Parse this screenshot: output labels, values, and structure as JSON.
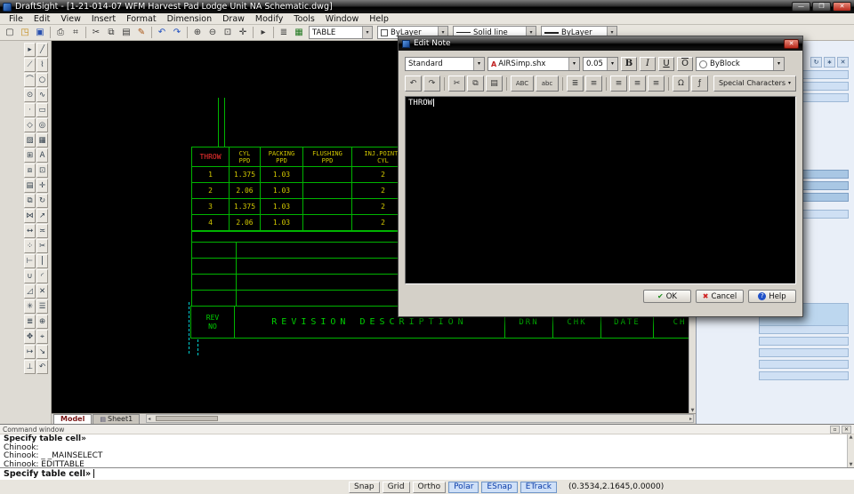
{
  "titlebar": {
    "title": "DraftSight - [1-21-014-07 WFM Harvest Pad Lodge Unit NA Schematic.dwg]"
  },
  "menu": {
    "items": [
      "File",
      "Edit",
      "View",
      "Insert",
      "Format",
      "Dimension",
      "Draw",
      "Modify",
      "Tools",
      "Window",
      "Help"
    ]
  },
  "toolbar": {
    "icons": [
      {
        "name": "new",
        "glyph": "▢"
      },
      {
        "name": "open",
        "glyph": "◳",
        "color": "#c28a18"
      },
      {
        "name": "save",
        "glyph": "▣",
        "color": "#2850b0"
      },
      {
        "sep": true
      },
      {
        "name": "print",
        "glyph": "⎙"
      },
      {
        "name": "print-preview",
        "glyph": "⌗"
      },
      {
        "sep": true
      },
      {
        "name": "cut",
        "glyph": "✂"
      },
      {
        "name": "copy",
        "glyph": "⧉"
      },
      {
        "name": "paste",
        "glyph": "▤"
      },
      {
        "name": "format-painter",
        "glyph": "✎",
        "color": "#a85414"
      },
      {
        "sep": true
      },
      {
        "name": "undo",
        "glyph": "↶",
        "color": "#2050c0"
      },
      {
        "name": "redo",
        "glyph": "↷",
        "color": "#2050c0"
      },
      {
        "sep": true
      },
      {
        "name": "zoom-in",
        "glyph": "⊕"
      },
      {
        "name": "zoom-out",
        "glyph": "⊖"
      },
      {
        "name": "zoom-window",
        "glyph": "⊡"
      },
      {
        "name": "pan",
        "glyph": "✛"
      },
      {
        "sep": true
      },
      {
        "name": "select",
        "glyph": "▸"
      },
      {
        "sep": true
      },
      {
        "name": "layers-manager",
        "glyph": "≣"
      },
      {
        "name": "layer-color",
        "glyph": "▦",
        "color": "#207820"
      }
    ],
    "layer_combo": "TABLE",
    "color_combo": "ByLayer",
    "linestyle_combo": "Solid line",
    "lineweight_combo": "ByLayer"
  },
  "tool_palette": {
    "tools": [
      {
        "name": "select",
        "glyph": "▸"
      },
      {
        "name": "line",
        "glyph": "╱"
      },
      {
        "name": "infinite-line",
        "glyph": "⟋"
      },
      {
        "name": "polyline",
        "glyph": "⌇"
      },
      {
        "name": "arc",
        "glyph": "⌒"
      },
      {
        "name": "circle",
        "glyph": "○"
      },
      {
        "name": "ellipse",
        "glyph": "⊙"
      },
      {
        "name": "spline",
        "glyph": "∿"
      },
      {
        "name": "point",
        "glyph": "·"
      },
      {
        "name": "rectangle",
        "glyph": "▭"
      },
      {
        "name": "polygon",
        "glyph": "◇"
      },
      {
        "name": "ring",
        "glyph": "◎"
      },
      {
        "name": "hatch",
        "glyph": "▨"
      },
      {
        "name": "area",
        "glyph": "▦"
      },
      {
        "name": "table",
        "glyph": "⊞"
      },
      {
        "name": "note",
        "glyph": "A"
      },
      {
        "name": "make-block",
        "glyph": "⧈"
      },
      {
        "name": "insert-block",
        "glyph": "⊡"
      },
      {
        "name": "image",
        "glyph": "▤"
      },
      {
        "name": "move",
        "glyph": "✛"
      },
      {
        "name": "copy-entity",
        "glyph": "⧉"
      },
      {
        "name": "rotate",
        "glyph": "↻"
      },
      {
        "name": "mirror",
        "glyph": "⋈"
      },
      {
        "name": "scale",
        "glyph": "↗"
      },
      {
        "name": "stretch",
        "glyph": "↔"
      },
      {
        "name": "offset",
        "glyph": "≍"
      },
      {
        "name": "pattern",
        "glyph": "⁘"
      },
      {
        "name": "trim",
        "glyph": "✂"
      },
      {
        "name": "extend",
        "glyph": "⊢"
      },
      {
        "name": "split",
        "glyph": "⎮"
      },
      {
        "name": "weld",
        "glyph": "∪"
      },
      {
        "name": "fillet",
        "glyph": "◜"
      },
      {
        "name": "chamfer",
        "glyph": "◿"
      },
      {
        "name": "erase",
        "glyph": "✕"
      },
      {
        "name": "explode",
        "glyph": "✳"
      },
      {
        "name": "properties",
        "glyph": "☰"
      },
      {
        "name": "layers",
        "glyph": "≣"
      },
      {
        "name": "zoom",
        "glyph": "⊕"
      },
      {
        "name": "pan",
        "glyph": "✥"
      },
      {
        "name": "measure",
        "glyph": "⌖"
      },
      {
        "name": "dimension",
        "glyph": "↦"
      },
      {
        "name": "leader",
        "glyph": "↘"
      },
      {
        "name": "tolerance",
        "glyph": "⊥"
      },
      {
        "name": "undo",
        "glyph": "↶"
      }
    ]
  },
  "canvas": {
    "table": {
      "edited_cell": "THROW",
      "headers": [
        "CYL\nPPD",
        "PACKING\nPPD",
        "FLUSHING\nPPD",
        "INJ.POINTS\nCYL"
      ],
      "rows": [
        [
          "1",
          "1.375",
          "1.03",
          "",
          "2"
        ],
        [
          "2",
          "2.06",
          "1.03",
          "",
          "2"
        ],
        [
          "3",
          "1.375",
          "1.03",
          "",
          "2"
        ],
        [
          "4",
          "2.06",
          "1.03",
          "",
          "2"
        ]
      ]
    },
    "revision": {
      "rev_no": "REV\nNO",
      "description": "REVISION DESCRIPTION",
      "drn": "DRN",
      "chk": "CHK",
      "date": "DATE",
      "partial": "CH"
    },
    "colors": {
      "line": "#00b400",
      "text": "#d2c800",
      "highlight": "#ff3232",
      "selection": "#00d0d0"
    }
  },
  "sheet_tabs": {
    "model": "Model",
    "sheet1": "Sheet1"
  },
  "dialog": {
    "title": "Edit Note",
    "style_combo": "Standard",
    "font_combo": "AIRSimp.shx",
    "size_combo": "0.05",
    "format_buttons": {
      "bold": "B",
      "italic": "I",
      "underline": "U",
      "overline": "O"
    },
    "color_combo": "ByBlock",
    "toolbar_icons": [
      {
        "name": "undo",
        "glyph": "↶"
      },
      {
        "name": "redo",
        "glyph": "↷"
      },
      {
        "sep": true
      },
      {
        "name": "cut",
        "glyph": "✂"
      },
      {
        "name": "copy",
        "glyph": "⧉"
      },
      {
        "name": "paste",
        "glyph": "▤"
      },
      {
        "sep": true
      },
      {
        "name": "spell-check",
        "glyph": "ABC",
        "wide": true
      },
      {
        "name": "lowercase",
        "glyph": "abc",
        "wide": true
      },
      {
        "sep": true
      },
      {
        "name": "numbered-list",
        "glyph": "≣"
      },
      {
        "name": "bullet-list",
        "glyph": "≡"
      },
      {
        "sep": true
      },
      {
        "name": "align-left",
        "glyph": "≡"
      },
      {
        "name": "align-center",
        "glyph": "≡"
      },
      {
        "name": "align-right",
        "glyph": "≡"
      },
      {
        "sep": true
      },
      {
        "name": "insert-symbol",
        "glyph": "Ω"
      },
      {
        "name": "insert-field",
        "glyph": "ƒ"
      }
    ],
    "special_characters": "Special Characters",
    "note_text": "THROW",
    "buttons": {
      "ok": "OK",
      "cancel": "Cancel",
      "help": "Help"
    }
  },
  "command_window": {
    "title": "Command window",
    "history": [
      {
        "text": "Specify table cell»",
        "bold": true
      },
      {
        "text": "Chinook:",
        "bold": false
      },
      {
        "text": "Chinook: _ _MAINSELECT",
        "bold": false
      },
      {
        "text": "Chinook: EDITTABLE",
        "bold": false
      }
    ],
    "prompt": "Specify table cell»"
  },
  "status_bar": {
    "toggles": [
      {
        "label": "Snap",
        "active": false
      },
      {
        "label": "Grid",
        "active": false
      },
      {
        "label": "Ortho",
        "active": false
      },
      {
        "label": "Polar",
        "active": true
      },
      {
        "label": "ESnap",
        "active": true
      },
      {
        "label": "ETrack",
        "active": true
      }
    ],
    "coordinates": "(0.3534,2.1645,0.0000)"
  }
}
